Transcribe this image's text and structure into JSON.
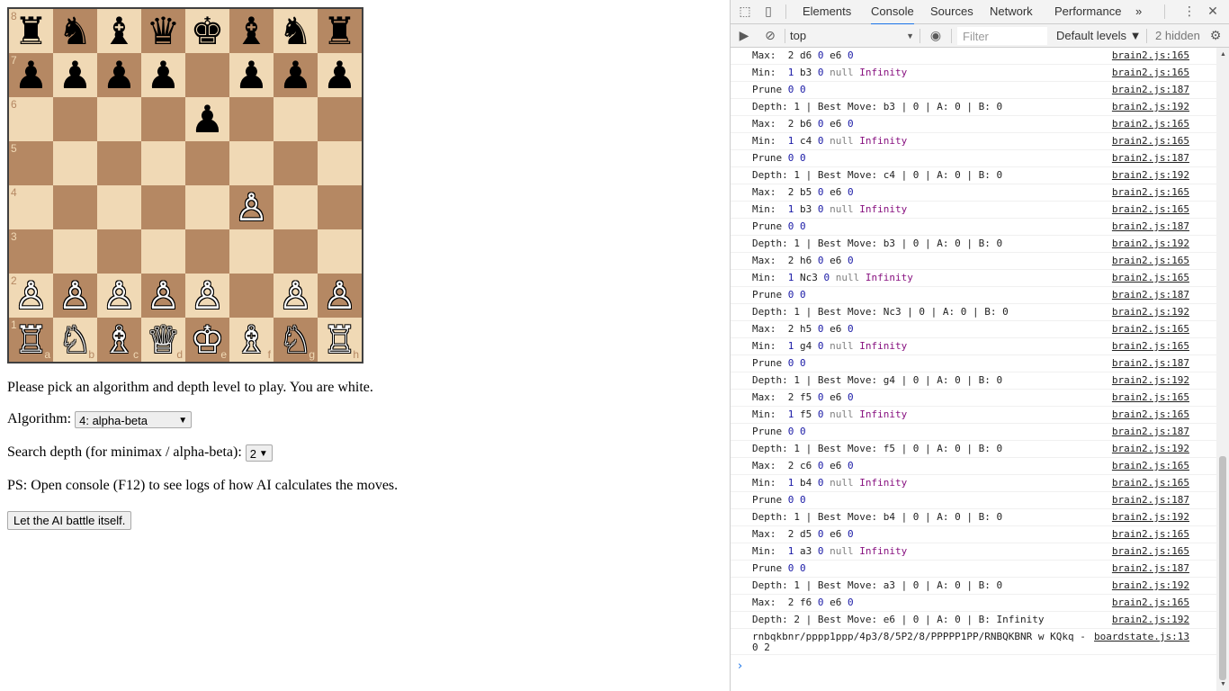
{
  "board": {
    "rows": [
      [
        "♜",
        "♞",
        "♝",
        "♛",
        "♚",
        "♝",
        "♞",
        "♜"
      ],
      [
        "♟",
        "♟",
        "♟",
        "♟",
        "",
        "♟",
        "♟",
        "♟"
      ],
      [
        "",
        "",
        "",
        "",
        "♟",
        "",
        "",
        ""
      ],
      [
        "",
        "",
        "",
        "",
        "",
        "",
        "",
        ""
      ],
      [
        "",
        "",
        "",
        "",
        "",
        "♙",
        "",
        ""
      ],
      [
        "",
        "",
        "",
        "",
        "",
        "",
        "",
        ""
      ],
      [
        "♙",
        "♙",
        "♙",
        "♙",
        "♙",
        "",
        "♙",
        "♙"
      ],
      [
        "♖",
        "♘",
        "♗",
        "♕",
        "♔",
        "♗",
        "♘",
        "♖"
      ]
    ],
    "colors": [
      [
        "b",
        "b",
        "b",
        "b",
        "b",
        "b",
        "b",
        "b"
      ],
      [
        "b",
        "b",
        "b",
        "b",
        "",
        "b",
        "b",
        "b"
      ],
      [
        "",
        "",
        "",
        "",
        "b",
        "",
        "",
        ""
      ],
      [
        "",
        "",
        "",
        "",
        "",
        "",
        "",
        ""
      ],
      [
        "",
        "",
        "",
        "",
        "",
        "w",
        "",
        ""
      ],
      [
        "",
        "",
        "",
        "",
        "",
        "",
        "",
        ""
      ],
      [
        "w",
        "w",
        "w",
        "w",
        "w",
        "",
        "w",
        "w"
      ],
      [
        "w",
        "w",
        "w",
        "w",
        "w",
        "w",
        "w",
        "w"
      ]
    ],
    "ranks": [
      "8",
      "7",
      "6",
      "5",
      "4",
      "3",
      "2",
      "1"
    ],
    "files": [
      "a",
      "b",
      "c",
      "d",
      "e",
      "f",
      "g",
      "h"
    ],
    "light_color": "#f0d9b5",
    "dark_color": "#b58863"
  },
  "page": {
    "intro": "Please pick an algorithm and depth level to play. You are white.",
    "algorithm_label": "Algorithm:",
    "algorithm_value": "4: alpha-beta",
    "depth_label": "Search depth (for minimax / alpha-beta):",
    "depth_value": "2",
    "ps": "PS: Open console (F12) to see logs of how AI calculates the moves.",
    "battle_button": "Let the AI battle itself."
  },
  "devtools": {
    "tabs": [
      "Elements",
      "Console",
      "Sources",
      "Network",
      "Performance"
    ],
    "active_tab": "Console",
    "more_tabs": "»",
    "context": "top",
    "filter_placeholder": "Filter",
    "levels": "Default levels ▼",
    "hidden": "2 hidden",
    "accent": "#1a73e8"
  },
  "console": {
    "scroll_fraction_top": 0.64,
    "scroll_fraction_size": 0.36,
    "rows": [
      {
        "parts": [
          [
            "t",
            "Max:  2 d6 "
          ],
          [
            "n",
            "0"
          ],
          [
            "t",
            " e6 "
          ],
          [
            "n",
            "0"
          ]
        ],
        "src": "brain2.js:165"
      },
      {
        "parts": [
          [
            "t",
            "Min:  "
          ],
          [
            "n",
            "1"
          ],
          [
            "t",
            " b3 "
          ],
          [
            "n",
            "0"
          ],
          [
            "t",
            " "
          ],
          [
            "x",
            "null"
          ],
          [
            "t",
            " "
          ],
          [
            "i",
            "Infinity"
          ]
        ],
        "src": "brain2.js:165"
      },
      {
        "parts": [
          [
            "t",
            "Prune "
          ],
          [
            "n",
            "0"
          ],
          [
            "t",
            " "
          ],
          [
            "n",
            "0"
          ]
        ],
        "src": "brain2.js:187"
      },
      {
        "parts": [
          [
            "t",
            "Depth: 1 | Best Move: b3 | 0 | A: 0 | B: 0"
          ]
        ],
        "src": "brain2.js:192"
      },
      {
        "parts": [
          [
            "t",
            "Max:  2 b6 "
          ],
          [
            "n",
            "0"
          ],
          [
            "t",
            " e6 "
          ],
          [
            "n",
            "0"
          ]
        ],
        "src": "brain2.js:165"
      },
      {
        "parts": [
          [
            "t",
            "Min:  "
          ],
          [
            "n",
            "1"
          ],
          [
            "t",
            " c4 "
          ],
          [
            "n",
            "0"
          ],
          [
            "t",
            " "
          ],
          [
            "x",
            "null"
          ],
          [
            "t",
            " "
          ],
          [
            "i",
            "Infinity"
          ]
        ],
        "src": "brain2.js:165"
      },
      {
        "parts": [
          [
            "t",
            "Prune "
          ],
          [
            "n",
            "0"
          ],
          [
            "t",
            " "
          ],
          [
            "n",
            "0"
          ]
        ],
        "src": "brain2.js:187"
      },
      {
        "parts": [
          [
            "t",
            "Depth: 1 | Best Move: c4 | 0 | A: 0 | B: 0"
          ]
        ],
        "src": "brain2.js:192"
      },
      {
        "parts": [
          [
            "t",
            "Max:  2 b5 "
          ],
          [
            "n",
            "0"
          ],
          [
            "t",
            " e6 "
          ],
          [
            "n",
            "0"
          ]
        ],
        "src": "brain2.js:165"
      },
      {
        "parts": [
          [
            "t",
            "Min:  "
          ],
          [
            "n",
            "1"
          ],
          [
            "t",
            " b3 "
          ],
          [
            "n",
            "0"
          ],
          [
            "t",
            " "
          ],
          [
            "x",
            "null"
          ],
          [
            "t",
            " "
          ],
          [
            "i",
            "Infinity"
          ]
        ],
        "src": "brain2.js:165"
      },
      {
        "parts": [
          [
            "t",
            "Prune "
          ],
          [
            "n",
            "0"
          ],
          [
            "t",
            " "
          ],
          [
            "n",
            "0"
          ]
        ],
        "src": "brain2.js:187"
      },
      {
        "parts": [
          [
            "t",
            "Depth: 1 | Best Move: b3 | 0 | A: 0 | B: 0"
          ]
        ],
        "src": "brain2.js:192"
      },
      {
        "parts": [
          [
            "t",
            "Max:  2 h6 "
          ],
          [
            "n",
            "0"
          ],
          [
            "t",
            " e6 "
          ],
          [
            "n",
            "0"
          ]
        ],
        "src": "brain2.js:165"
      },
      {
        "parts": [
          [
            "t",
            "Min:  "
          ],
          [
            "n",
            "1"
          ],
          [
            "t",
            " Nc3 "
          ],
          [
            "n",
            "0"
          ],
          [
            "t",
            " "
          ],
          [
            "x",
            "null"
          ],
          [
            "t",
            " "
          ],
          [
            "i",
            "Infinity"
          ]
        ],
        "src": "brain2.js:165"
      },
      {
        "parts": [
          [
            "t",
            "Prune "
          ],
          [
            "n",
            "0"
          ],
          [
            "t",
            " "
          ],
          [
            "n",
            "0"
          ]
        ],
        "src": "brain2.js:187"
      },
      {
        "parts": [
          [
            "t",
            "Depth: 1 | Best Move: Nc3 | 0 | A: 0 | B: 0"
          ]
        ],
        "src": "brain2.js:192"
      },
      {
        "parts": [
          [
            "t",
            "Max:  2 h5 "
          ],
          [
            "n",
            "0"
          ],
          [
            "t",
            " e6 "
          ],
          [
            "n",
            "0"
          ]
        ],
        "src": "brain2.js:165"
      },
      {
        "parts": [
          [
            "t",
            "Min:  "
          ],
          [
            "n",
            "1"
          ],
          [
            "t",
            " g4 "
          ],
          [
            "n",
            "0"
          ],
          [
            "t",
            " "
          ],
          [
            "x",
            "null"
          ],
          [
            "t",
            " "
          ],
          [
            "i",
            "Infinity"
          ]
        ],
        "src": "brain2.js:165"
      },
      {
        "parts": [
          [
            "t",
            "Prune "
          ],
          [
            "n",
            "0"
          ],
          [
            "t",
            " "
          ],
          [
            "n",
            "0"
          ]
        ],
        "src": "brain2.js:187"
      },
      {
        "parts": [
          [
            "t",
            "Depth: 1 | Best Move: g4 | 0 | A: 0 | B: 0"
          ]
        ],
        "src": "brain2.js:192"
      },
      {
        "parts": [
          [
            "t",
            "Max:  2 f5 "
          ],
          [
            "n",
            "0"
          ],
          [
            "t",
            " e6 "
          ],
          [
            "n",
            "0"
          ]
        ],
        "src": "brain2.js:165"
      },
      {
        "parts": [
          [
            "t",
            "Min:  "
          ],
          [
            "n",
            "1"
          ],
          [
            "t",
            " f5 "
          ],
          [
            "n",
            "0"
          ],
          [
            "t",
            " "
          ],
          [
            "x",
            "null"
          ],
          [
            "t",
            " "
          ],
          [
            "i",
            "Infinity"
          ]
        ],
        "src": "brain2.js:165"
      },
      {
        "parts": [
          [
            "t",
            "Prune "
          ],
          [
            "n",
            "0"
          ],
          [
            "t",
            " "
          ],
          [
            "n",
            "0"
          ]
        ],
        "src": "brain2.js:187"
      },
      {
        "parts": [
          [
            "t",
            "Depth: 1 | Best Move: f5 | 0 | A: 0 | B: 0"
          ]
        ],
        "src": "brain2.js:192"
      },
      {
        "parts": [
          [
            "t",
            "Max:  2 c6 "
          ],
          [
            "n",
            "0"
          ],
          [
            "t",
            " e6 "
          ],
          [
            "n",
            "0"
          ]
        ],
        "src": "brain2.js:165"
      },
      {
        "parts": [
          [
            "t",
            "Min:  "
          ],
          [
            "n",
            "1"
          ],
          [
            "t",
            " b4 "
          ],
          [
            "n",
            "0"
          ],
          [
            "t",
            " "
          ],
          [
            "x",
            "null"
          ],
          [
            "t",
            " "
          ],
          [
            "i",
            "Infinity"
          ]
        ],
        "src": "brain2.js:165"
      },
      {
        "parts": [
          [
            "t",
            "Prune "
          ],
          [
            "n",
            "0"
          ],
          [
            "t",
            " "
          ],
          [
            "n",
            "0"
          ]
        ],
        "src": "brain2.js:187"
      },
      {
        "parts": [
          [
            "t",
            "Depth: 1 | Best Move: b4 | 0 | A: 0 | B: 0"
          ]
        ],
        "src": "brain2.js:192"
      },
      {
        "parts": [
          [
            "t",
            "Max:  2 d5 "
          ],
          [
            "n",
            "0"
          ],
          [
            "t",
            " e6 "
          ],
          [
            "n",
            "0"
          ]
        ],
        "src": "brain2.js:165"
      },
      {
        "parts": [
          [
            "t",
            "Min:  "
          ],
          [
            "n",
            "1"
          ],
          [
            "t",
            " a3 "
          ],
          [
            "n",
            "0"
          ],
          [
            "t",
            " "
          ],
          [
            "x",
            "null"
          ],
          [
            "t",
            " "
          ],
          [
            "i",
            "Infinity"
          ]
        ],
        "src": "brain2.js:165"
      },
      {
        "parts": [
          [
            "t",
            "Prune "
          ],
          [
            "n",
            "0"
          ],
          [
            "t",
            " "
          ],
          [
            "n",
            "0"
          ]
        ],
        "src": "brain2.js:187"
      },
      {
        "parts": [
          [
            "t",
            "Depth: 1 | Best Move: a3 | 0 | A: 0 | B: 0"
          ]
        ],
        "src": "brain2.js:192"
      },
      {
        "parts": [
          [
            "t",
            "Max:  2 f6 "
          ],
          [
            "n",
            "0"
          ],
          [
            "t",
            " e6 "
          ],
          [
            "n",
            "0"
          ]
        ],
        "src": "brain2.js:165"
      },
      {
        "parts": [
          [
            "t",
            "Depth: 2 | Best Move: e6 | 0 | A: 0 | B: Infinity"
          ]
        ],
        "src": "brain2.js:192"
      }
    ],
    "fen_line1": "rnbqkbnr/pppp1ppp/4p3/8/5P2/8/PPPPP1PP/RNBQKBNR w KQkq -",
    "fen_line2": "0 2",
    "fen_src": "boardstate.js:13",
    "prompt": "›"
  }
}
